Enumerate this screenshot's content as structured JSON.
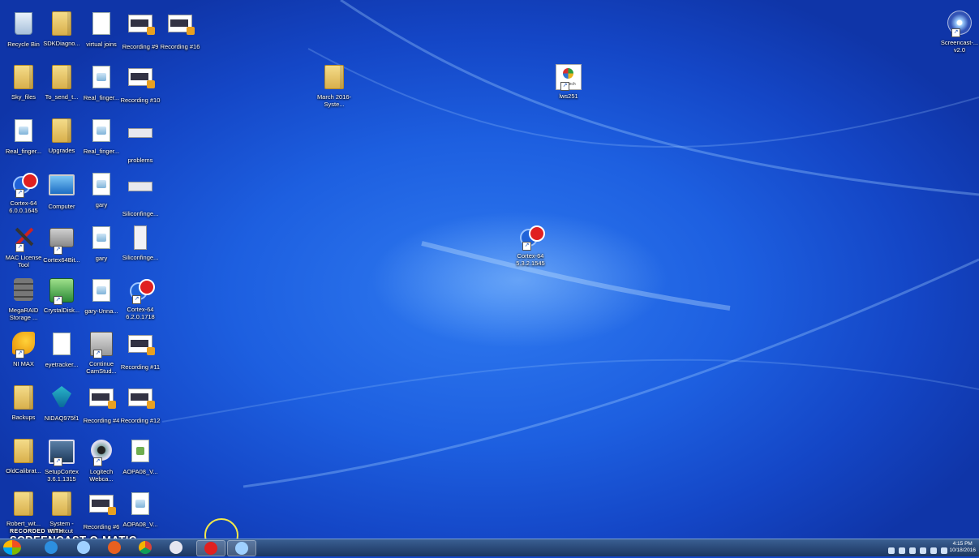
{
  "desktop": {
    "icons": [
      {
        "label": "Recycle Bin",
        "icon": "recycle-bin-icon"
      },
      {
        "label": "SDKDiagno...",
        "icon": "folder-icon"
      },
      {
        "label": "virtual joins",
        "icon": "document-icon"
      },
      {
        "label": "Recording #9",
        "icon": "video-file-icon"
      },
      {
        "label": "Recording #16",
        "icon": "video-file-icon"
      },
      {
        "label": "Sky_files",
        "icon": "folder-icon"
      },
      {
        "label": "To_send_t...",
        "icon": "folder-icon"
      },
      {
        "label": "Real_finger...",
        "icon": "document-icon"
      },
      {
        "label": "Recording #10",
        "icon": "video-file-icon"
      },
      {
        "label": "Real_finger...",
        "icon": "document-icon"
      },
      {
        "label": "Upgrades",
        "icon": "folder-icon"
      },
      {
        "label": "Real_finger...",
        "icon": "document-icon"
      },
      {
        "label": "problems",
        "icon": "image-file-icon"
      },
      {
        "label": "Cortex-64 6.0.0.1645",
        "icon": "cortex-app-icon"
      },
      {
        "label": "Computer",
        "icon": "computer-icon"
      },
      {
        "label": "gary",
        "icon": "document-icon"
      },
      {
        "label": "Siliconfinge...",
        "icon": "image-file-icon"
      },
      {
        "label": "MAC License Tool",
        "icon": "tools-icon"
      },
      {
        "label": "Cortex64Bit...",
        "icon": "camera-device-icon"
      },
      {
        "label": "gary",
        "icon": "document-icon"
      },
      {
        "label": "Siliconfinge...",
        "icon": "image-file-icon"
      },
      {
        "label": "MegaRAID Storage ...",
        "icon": "database-icon"
      },
      {
        "label": "CrystalDisk...",
        "icon": "disk-tool-icon"
      },
      {
        "label": "gary-Unna...",
        "icon": "document-icon"
      },
      {
        "label": "Cortex-64 6.2.0.1718",
        "icon": "cortex-app-icon"
      },
      {
        "label": "NI MAX",
        "icon": "ni-max-icon"
      },
      {
        "label": "eyetracker...",
        "icon": "document-icon"
      },
      {
        "label": "Continue CamStud...",
        "icon": "installer-icon"
      },
      {
        "label": "Recording #11",
        "icon": "video-file-icon"
      },
      {
        "label": "Backups",
        "icon": "folder-icon"
      },
      {
        "label": "NIDAQ975f1",
        "icon": "nidaq-icon"
      },
      {
        "label": "Recording #4",
        "icon": "video-file-icon"
      },
      {
        "label": "Recording #12",
        "icon": "video-file-icon"
      },
      {
        "label": "OldCalibrat...",
        "icon": "folder-icon"
      },
      {
        "label": "SetupCortex 3.6.1.1315",
        "icon": "setup-icon"
      },
      {
        "label": "Logitech Webca...",
        "icon": "webcam-icon"
      },
      {
        "label": "AOPA08_V...",
        "icon": "spreadsheet-icon"
      },
      {
        "label": "Robert_wit...",
        "icon": "folder-icon"
      },
      {
        "label": "System - Shortcut",
        "icon": "folder-icon"
      },
      {
        "label": "Recording #6",
        "icon": "video-file-icon"
      },
      {
        "label": "AOPA08_V...",
        "icon": "document-icon"
      },
      {
        "label": "March 2016-Syste...",
        "icon": "folder-icon"
      },
      {
        "label": "lws251",
        "icon": "logitech-icon"
      },
      {
        "label": "Cortex-64 5.3.2.1545",
        "icon": "cortex-app-icon"
      },
      {
        "label": "Screencast-... v2.0",
        "icon": "screencast-icon"
      }
    ]
  },
  "watermark": {
    "line1": "RECORDED WITH",
    "line2": "SCREENCAST-O-MATIC"
  },
  "taskbar": {
    "clock_time": "4:15 PM",
    "clock_date": "10/18/2016"
  },
  "colors": {
    "desktop_blue": "#1d5fe0",
    "taskbar": "#1c3660",
    "cursor_highlight": "#f3e84a"
  }
}
